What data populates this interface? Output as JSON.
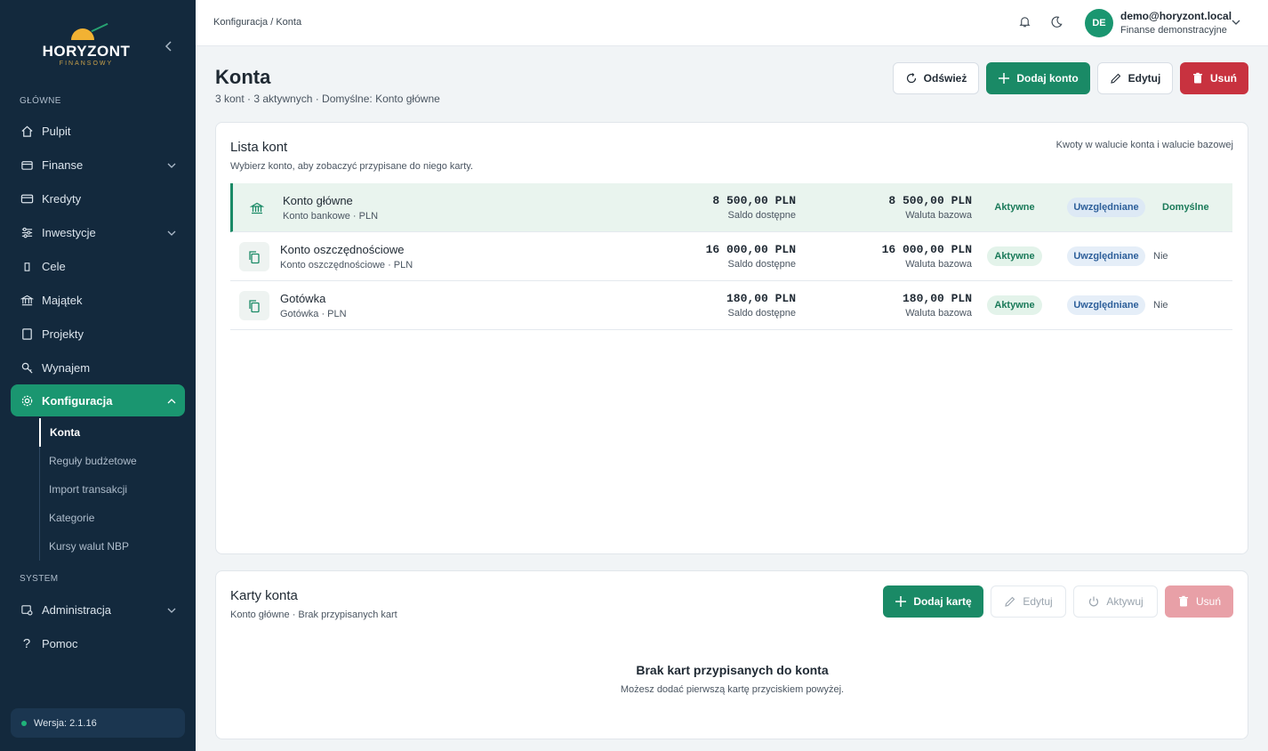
{
  "brand": {
    "name": "HORYZONT",
    "tagline": "FINANSOWY"
  },
  "sidebar": {
    "section_main": "GŁÓWNE",
    "section_system": "SYSTEM",
    "items": [
      {
        "label": "Pulpit",
        "icon": "home-icon"
      },
      {
        "label": "Finanse",
        "icon": "wallet-icon"
      },
      {
        "label": "Kredyty",
        "icon": "credit-card-icon"
      },
      {
        "label": "Inwestycje",
        "icon": "sliders-icon"
      },
      {
        "label": "Cele",
        "icon": "target-icon"
      },
      {
        "label": "Majątek",
        "icon": "bank-icon"
      },
      {
        "label": "Projekty",
        "icon": "document-icon"
      },
      {
        "label": "Wynajem",
        "icon": "key-icon"
      },
      {
        "label": "Konfiguracja",
        "icon": "gear-icon"
      }
    ],
    "sub_items": [
      "Konta",
      "Reguły budżetowe",
      "Import transakcji",
      "Kategorie",
      "Kursy walut NBP"
    ],
    "system_items": [
      {
        "label": "Administracja",
        "icon": "user-admin-icon"
      },
      {
        "label": "Pomoc",
        "icon": "question-icon"
      }
    ],
    "version": "Wersja: 2.1.16"
  },
  "topbar": {
    "breadcrumb": "Konfiguracja / Konta",
    "avatar_initials": "DE",
    "user_email": "demo@horyzont.local",
    "user_org": "Finanse demonstracyjne"
  },
  "page": {
    "title": "Konta",
    "subtitle": "3 kont · 3 aktywnych · Domyślne: Konto główne",
    "buttons": {
      "refresh": "Odśwież",
      "add": "Dodaj konto",
      "edit": "Edytuj",
      "delete": "Usuń"
    }
  },
  "accounts_card": {
    "title": "Lista kont",
    "subtitle": "Wybierz konto, aby zobaczyć przypisane do niego karty.",
    "note": "Kwoty w walucie konta i walucie bazowej",
    "rows": [
      {
        "name": "Konto główne",
        "type": "Konto bankowe · PLN",
        "amount": "8 500,00 PLN",
        "amount_label": "Saldo dostępne",
        "base_amount": "8 500,00 PLN",
        "base_label": "Waluta bazowa",
        "status": "Aktywne",
        "included": "Uwzględniane",
        "default": "Domyślne",
        "icon": "bank-icon"
      },
      {
        "name": "Konto oszczędnościowe",
        "type": "Konto oszczędnościowe · PLN",
        "amount": "16 000,00 PLN",
        "amount_label": "Saldo dostępne",
        "base_amount": "16 000,00 PLN",
        "base_label": "Waluta bazowa",
        "status": "Aktywne",
        "included": "Uwzględniane",
        "default": "Nie",
        "icon": "copy-icon"
      },
      {
        "name": "Gotówka",
        "type": "Gotówka · PLN",
        "amount": "180,00 PLN",
        "amount_label": "Saldo dostępne",
        "base_amount": "180,00 PLN",
        "base_label": "Waluta bazowa",
        "status": "Aktywne",
        "included": "Uwzględniane",
        "default": "Nie",
        "icon": "copy-icon"
      }
    ]
  },
  "cards_card": {
    "title": "Karty konta",
    "subtitle": "Konto główne · Brak przypisanych kart",
    "buttons": {
      "add": "Dodaj kartę",
      "edit": "Edytuj",
      "activate": "Aktywuj",
      "delete": "Usuń"
    },
    "empty_title": "Brak kart przypisanych do konta",
    "empty_sub": "Możesz dodać pierwszą kartę przyciskiem powyżej."
  },
  "colors": {
    "sidebar": "#13293d",
    "accent": "#1a8a66",
    "danger": "#c8323f"
  }
}
